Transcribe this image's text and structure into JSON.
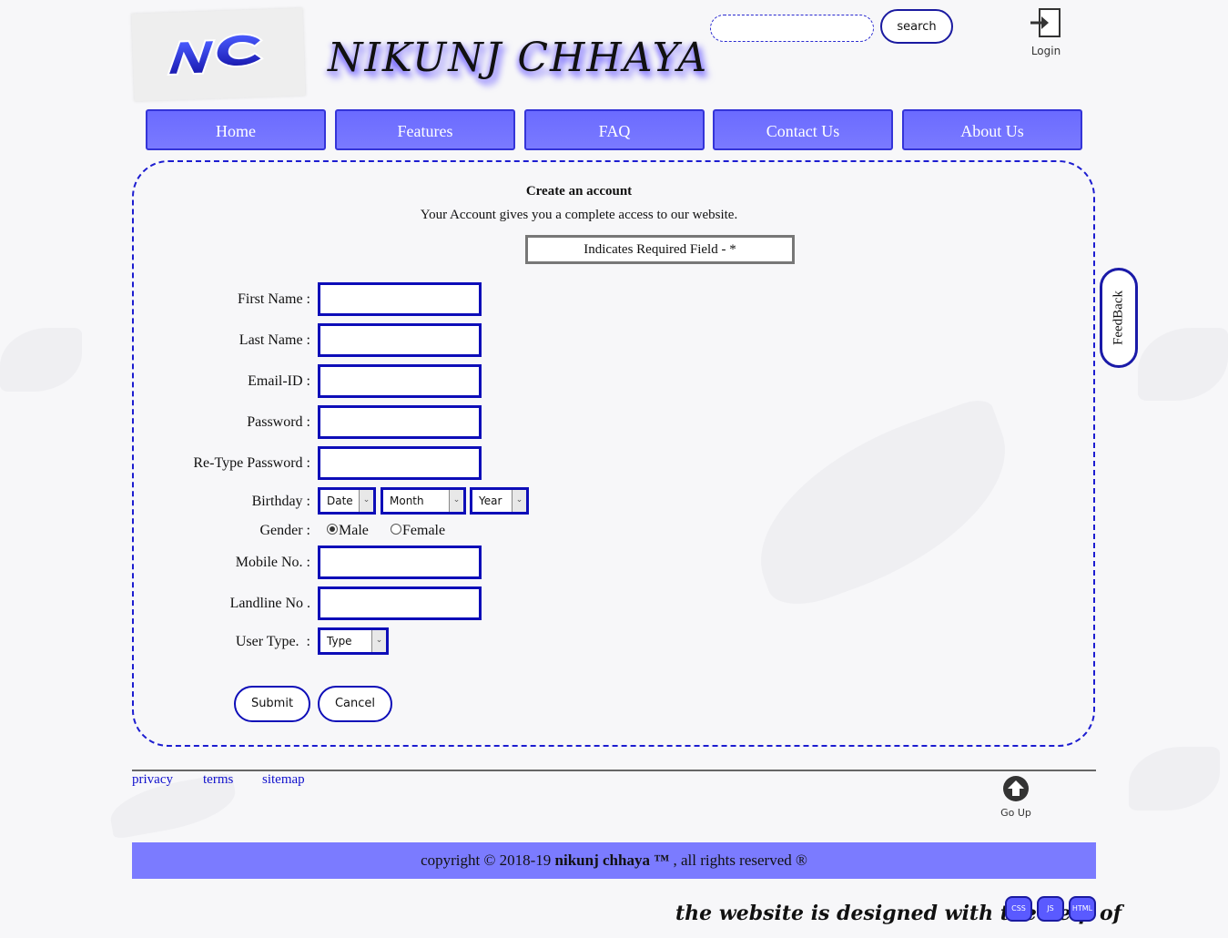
{
  "header": {
    "brand": "NIKUNJ CHHAYA",
    "logo_text": "NC",
    "search_placeholder": "",
    "search_button": "search",
    "login_label": "Login"
  },
  "nav": {
    "items": [
      "Home",
      "Features",
      "FAQ",
      "Contact Us",
      "About Us"
    ]
  },
  "form": {
    "title": "Create an account",
    "subtitle": "Your Account gives you a complete access to our website.",
    "required_note": "Indicates Required Field - *",
    "labels": {
      "first_name": "First Name :",
      "last_name": "Last Name :",
      "email": "Email-ID :",
      "password": "Password :",
      "retype_password": "Re-Type Password :",
      "birthday": "Birthday :",
      "gender": "Gender :",
      "mobile": "Mobile No. :",
      "landline": "Landline No .",
      "user_type": "User Type.  :"
    },
    "birthday": {
      "date": "Date",
      "month": "Month",
      "year": "Year"
    },
    "gender": {
      "male": "Male",
      "female": "Female",
      "selected": "Male"
    },
    "user_type": "Type",
    "submit": "Submit",
    "cancel": "Cancel"
  },
  "feedback_label": "FeedBack",
  "footer": {
    "links": [
      "privacy",
      "terms",
      "sitemap"
    ],
    "go_up": "Go Up",
    "copyright_prefix": "copyright © 2018-19 ",
    "copyright_brand": "nikunj chhaya ™",
    "copyright_suffix": " , all rights reserved ®",
    "designed_with": "the website is designed with the help of",
    "tech_badges": [
      "CSS",
      "JS",
      "HTML"
    ]
  },
  "colors": {
    "accent": "#7b7bff",
    "border": "#0d0db8",
    "link": "#1010cc"
  }
}
